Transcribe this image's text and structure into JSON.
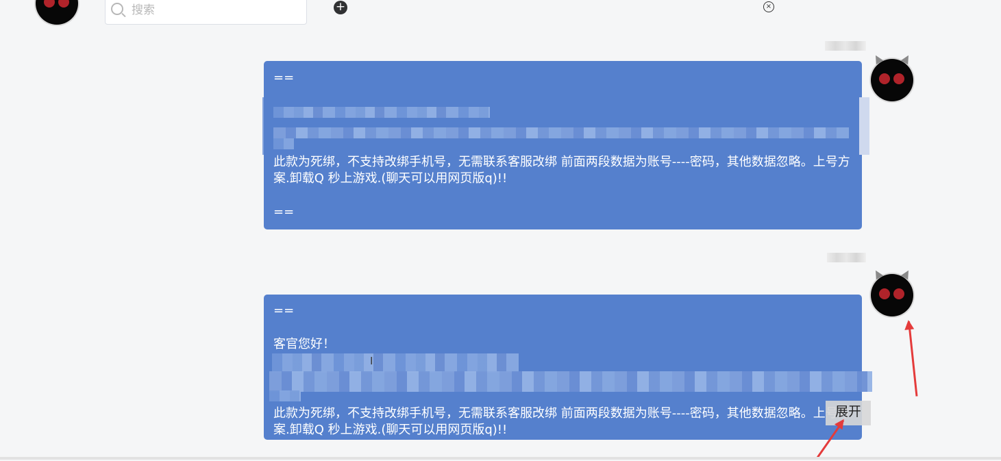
{
  "header": {
    "search_placeholder": "搜索",
    "add_icon": "+",
    "close_icon": "×"
  },
  "messages": [
    {
      "top_marker": "==",
      "body": "此款为死绑，不支持改绑手机号，无需联系客服改绑 前面两段数据为账号----密码，其他数据忽略。上号方案.卸载Q 秒上游戏.(聊天可以用网页版q)!!",
      "bottom_marker": "=="
    },
    {
      "top_marker": "==",
      "greeting": "客官您好！",
      "body": "此款为死绑，不支持改绑手机号，无需联系客服改绑 前面两段数据为账号----密码，其他数据忽略。上号方案.卸载Q 秒上游戏.(聊天可以用网页版q)!!",
      "expand_label": "展开"
    }
  ],
  "colors": {
    "bubble": "#5580cd",
    "page_bg": "#f5f6f7",
    "annotation_arrow": "#e43b3b"
  }
}
